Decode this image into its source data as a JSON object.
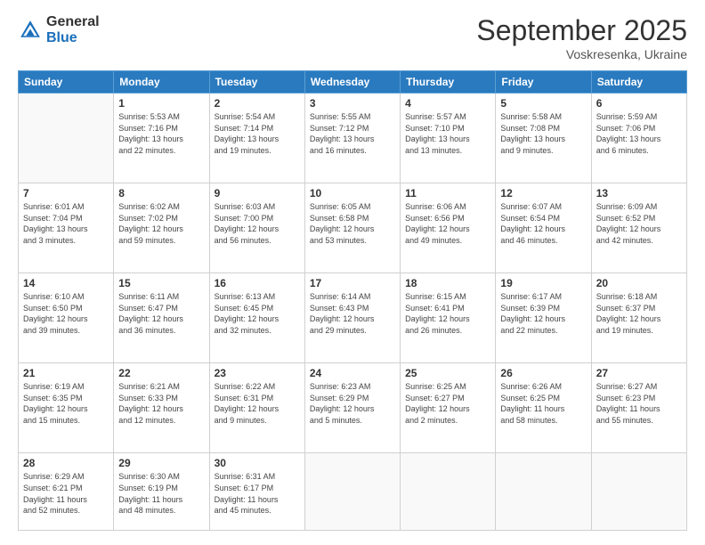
{
  "header": {
    "logo_general": "General",
    "logo_blue": "Blue",
    "month_title": "September 2025",
    "location": "Voskresenka, Ukraine"
  },
  "weekdays": [
    "Sunday",
    "Monday",
    "Tuesday",
    "Wednesday",
    "Thursday",
    "Friday",
    "Saturday"
  ],
  "weeks": [
    [
      {
        "day": "",
        "info": ""
      },
      {
        "day": "1",
        "info": "Sunrise: 5:53 AM\nSunset: 7:16 PM\nDaylight: 13 hours\nand 22 minutes."
      },
      {
        "day": "2",
        "info": "Sunrise: 5:54 AM\nSunset: 7:14 PM\nDaylight: 13 hours\nand 19 minutes."
      },
      {
        "day": "3",
        "info": "Sunrise: 5:55 AM\nSunset: 7:12 PM\nDaylight: 13 hours\nand 16 minutes."
      },
      {
        "day": "4",
        "info": "Sunrise: 5:57 AM\nSunset: 7:10 PM\nDaylight: 13 hours\nand 13 minutes."
      },
      {
        "day": "5",
        "info": "Sunrise: 5:58 AM\nSunset: 7:08 PM\nDaylight: 13 hours\nand 9 minutes."
      },
      {
        "day": "6",
        "info": "Sunrise: 5:59 AM\nSunset: 7:06 PM\nDaylight: 13 hours\nand 6 minutes."
      }
    ],
    [
      {
        "day": "7",
        "info": "Sunrise: 6:01 AM\nSunset: 7:04 PM\nDaylight: 13 hours\nand 3 minutes."
      },
      {
        "day": "8",
        "info": "Sunrise: 6:02 AM\nSunset: 7:02 PM\nDaylight: 12 hours\nand 59 minutes."
      },
      {
        "day": "9",
        "info": "Sunrise: 6:03 AM\nSunset: 7:00 PM\nDaylight: 12 hours\nand 56 minutes."
      },
      {
        "day": "10",
        "info": "Sunrise: 6:05 AM\nSunset: 6:58 PM\nDaylight: 12 hours\nand 53 minutes."
      },
      {
        "day": "11",
        "info": "Sunrise: 6:06 AM\nSunset: 6:56 PM\nDaylight: 12 hours\nand 49 minutes."
      },
      {
        "day": "12",
        "info": "Sunrise: 6:07 AM\nSunset: 6:54 PM\nDaylight: 12 hours\nand 46 minutes."
      },
      {
        "day": "13",
        "info": "Sunrise: 6:09 AM\nSunset: 6:52 PM\nDaylight: 12 hours\nand 42 minutes."
      }
    ],
    [
      {
        "day": "14",
        "info": "Sunrise: 6:10 AM\nSunset: 6:50 PM\nDaylight: 12 hours\nand 39 minutes."
      },
      {
        "day": "15",
        "info": "Sunrise: 6:11 AM\nSunset: 6:47 PM\nDaylight: 12 hours\nand 36 minutes."
      },
      {
        "day": "16",
        "info": "Sunrise: 6:13 AM\nSunset: 6:45 PM\nDaylight: 12 hours\nand 32 minutes."
      },
      {
        "day": "17",
        "info": "Sunrise: 6:14 AM\nSunset: 6:43 PM\nDaylight: 12 hours\nand 29 minutes."
      },
      {
        "day": "18",
        "info": "Sunrise: 6:15 AM\nSunset: 6:41 PM\nDaylight: 12 hours\nand 26 minutes."
      },
      {
        "day": "19",
        "info": "Sunrise: 6:17 AM\nSunset: 6:39 PM\nDaylight: 12 hours\nand 22 minutes."
      },
      {
        "day": "20",
        "info": "Sunrise: 6:18 AM\nSunset: 6:37 PM\nDaylight: 12 hours\nand 19 minutes."
      }
    ],
    [
      {
        "day": "21",
        "info": "Sunrise: 6:19 AM\nSunset: 6:35 PM\nDaylight: 12 hours\nand 15 minutes."
      },
      {
        "day": "22",
        "info": "Sunrise: 6:21 AM\nSunset: 6:33 PM\nDaylight: 12 hours\nand 12 minutes."
      },
      {
        "day": "23",
        "info": "Sunrise: 6:22 AM\nSunset: 6:31 PM\nDaylight: 12 hours\nand 9 minutes."
      },
      {
        "day": "24",
        "info": "Sunrise: 6:23 AM\nSunset: 6:29 PM\nDaylight: 12 hours\nand 5 minutes."
      },
      {
        "day": "25",
        "info": "Sunrise: 6:25 AM\nSunset: 6:27 PM\nDaylight: 12 hours\nand 2 minutes."
      },
      {
        "day": "26",
        "info": "Sunrise: 6:26 AM\nSunset: 6:25 PM\nDaylight: 11 hours\nand 58 minutes."
      },
      {
        "day": "27",
        "info": "Sunrise: 6:27 AM\nSunset: 6:23 PM\nDaylight: 11 hours\nand 55 minutes."
      }
    ],
    [
      {
        "day": "28",
        "info": "Sunrise: 6:29 AM\nSunset: 6:21 PM\nDaylight: 11 hours\nand 52 minutes."
      },
      {
        "day": "29",
        "info": "Sunrise: 6:30 AM\nSunset: 6:19 PM\nDaylight: 11 hours\nand 48 minutes."
      },
      {
        "day": "30",
        "info": "Sunrise: 6:31 AM\nSunset: 6:17 PM\nDaylight: 11 hours\nand 45 minutes."
      },
      {
        "day": "",
        "info": ""
      },
      {
        "day": "",
        "info": ""
      },
      {
        "day": "",
        "info": ""
      },
      {
        "day": "",
        "info": ""
      }
    ]
  ]
}
